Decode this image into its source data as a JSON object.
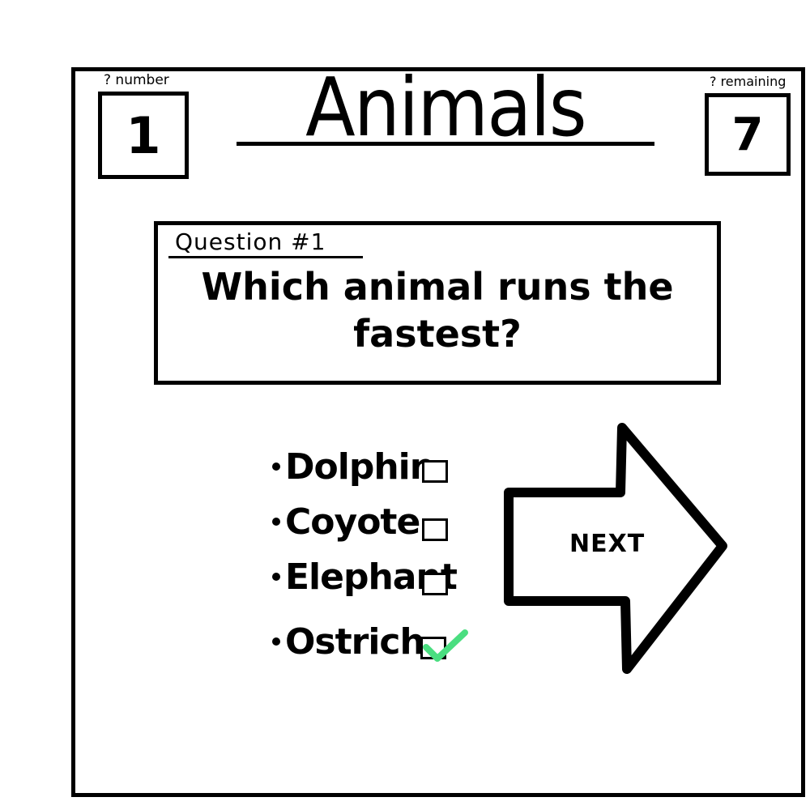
{
  "header": {
    "title": "Animals",
    "number_caption": "? number",
    "number_value": "1",
    "remaining_caption": "? remaining",
    "remaining_value": "7"
  },
  "question": {
    "label": "Question #1",
    "text": "Which animal runs the fastest?"
  },
  "options": [
    {
      "label": "Dolphin",
      "checked": false
    },
    {
      "label": "Coyote",
      "checked": false
    },
    {
      "label": "Elephant",
      "checked": false
    },
    {
      "label": "Ostrich",
      "checked": true
    }
  ],
  "next_button": {
    "label": "NEXT"
  },
  "colors": {
    "check_mark": "#4ade80",
    "ink": "#000000",
    "background": "#ffffff"
  },
  "icons": {
    "check": "check-icon",
    "next": "arrow-right-icon",
    "bullet": "bullet-icon"
  }
}
